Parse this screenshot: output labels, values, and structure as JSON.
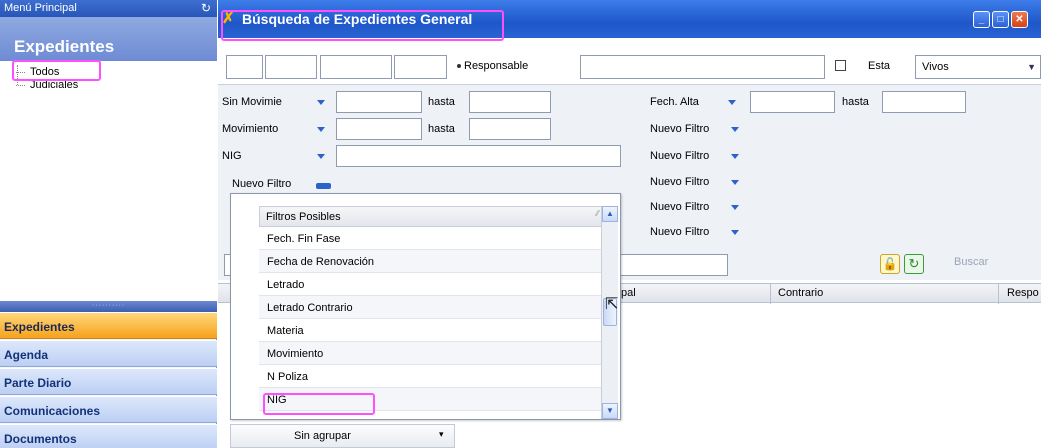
{
  "sidebar": {
    "header": "Menú Principal",
    "title": "Expedientes",
    "tree": [
      "Todos",
      "Judiciales"
    ],
    "buttons": [
      "Expedientes",
      "Agenda",
      "Parte Diario",
      "Comunicaciones",
      "Documentos"
    ],
    "active_button": "Expedientes"
  },
  "window": {
    "title": "Búsqueda de Expedientes General",
    "responsable_label": "Responsable",
    "esta_label": "Esta",
    "estado_value": "Vivos"
  },
  "filters": {
    "sin_movimiento": "Sin Movimie",
    "movimiento": "Movimiento",
    "nig": "NIG",
    "hasta": "hasta",
    "nuevo_filtro": "Nuevo Filtro",
    "fech_alta": "Fech. Alta",
    "right_nuevo_filtro": [
      "Nuevo Filtro",
      "Nuevo Filtro",
      "Nuevo Filtro",
      "Nuevo Filtro",
      "Nuevo Filtro"
    ]
  },
  "search": {
    "buscar_label": "Buscar"
  },
  "grid": {
    "columns": [
      "ıcipal",
      "Contrario",
      "Respo"
    ]
  },
  "groupby": {
    "value": "Sin agrupar"
  },
  "popup": {
    "header": "Filtros Posibles",
    "items": [
      "Fech. Fin Fase",
      "Fecha de Renovación",
      "Letrado",
      "Letrado Contrario",
      "Materia",
      "Movimiento",
      "N Poliza",
      "NIG"
    ]
  },
  "icons": {
    "refresh": "refresh-icon",
    "lock": "lock-icon",
    "reload": "reload-icon",
    "cursor": "mouse-cursor-icon"
  },
  "colors": {
    "highlight": "#ff4fff",
    "titlebar": "#1e57c9",
    "active_nav": "#f6a21c"
  }
}
